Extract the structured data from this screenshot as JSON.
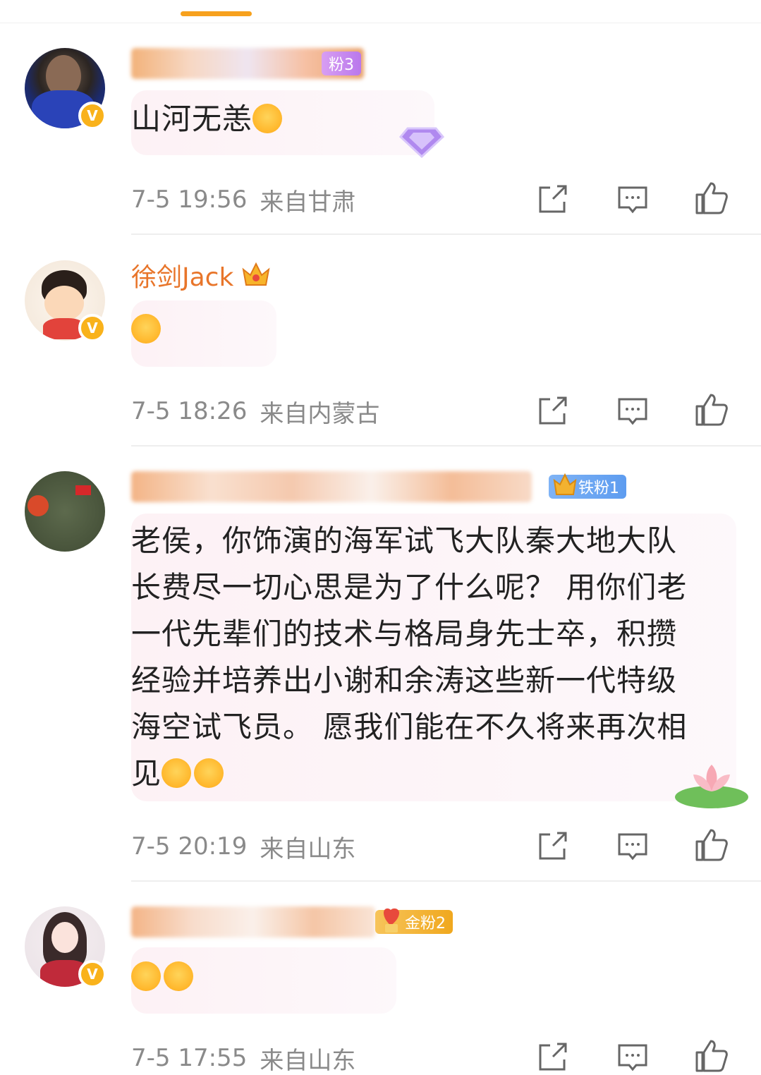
{
  "colors": {
    "accent": "#f7a11d",
    "username": "#e8752a",
    "meta": "#8a8a8a",
    "verified": "#f9b21b",
    "iron_badge": "#6aa6f2",
    "gold_badge": "#f3b230",
    "purple_badge": "#c58bef"
  },
  "comments": [
    {
      "username": "",
      "fan_badge": "粉3",
      "text": "山河无恙",
      "emojis": [
        "laughing-face-emoji"
      ],
      "time": "7-5 19:56",
      "location": "来自甘肃",
      "verified_icon": "V"
    },
    {
      "username": "徐剑Jack",
      "fan_badge": "",
      "text": "",
      "emojis": [
        "shy-face-emoji"
      ],
      "time": "7-5 18:26",
      "location": "来自内蒙古",
      "verified_icon": "V"
    },
    {
      "username": "",
      "fan_badge": "铁粉1",
      "text_lines": [
        "老侯，你饰演的海军试飞大队秦大地大队",
        "长费尽一切心思是为了什么呢？ 用你们老",
        "一代先辈们的技术与格局身先士卒，积攒",
        "经验并培养出小谢和余涛这些新一代特级",
        "海空试飞员。 愿我们能在不久将来再次相",
        "见"
      ],
      "emojis": [
        "headband-face-emoji",
        "headband-face-emoji"
      ],
      "time": "7-5 20:19",
      "location": "来自山东",
      "verified_icon": ""
    },
    {
      "username": "",
      "fan_badge": "金粉2",
      "text": "",
      "emojis": [
        "crying-laughing-emoji",
        "crying-laughing-emoji"
      ],
      "time": "7-5 17:55",
      "location": "来自山东",
      "verified_icon": "V"
    }
  ],
  "icons": {
    "share": "share-icon",
    "reply": "comment-icon",
    "like": "thumbs-up-icon"
  }
}
